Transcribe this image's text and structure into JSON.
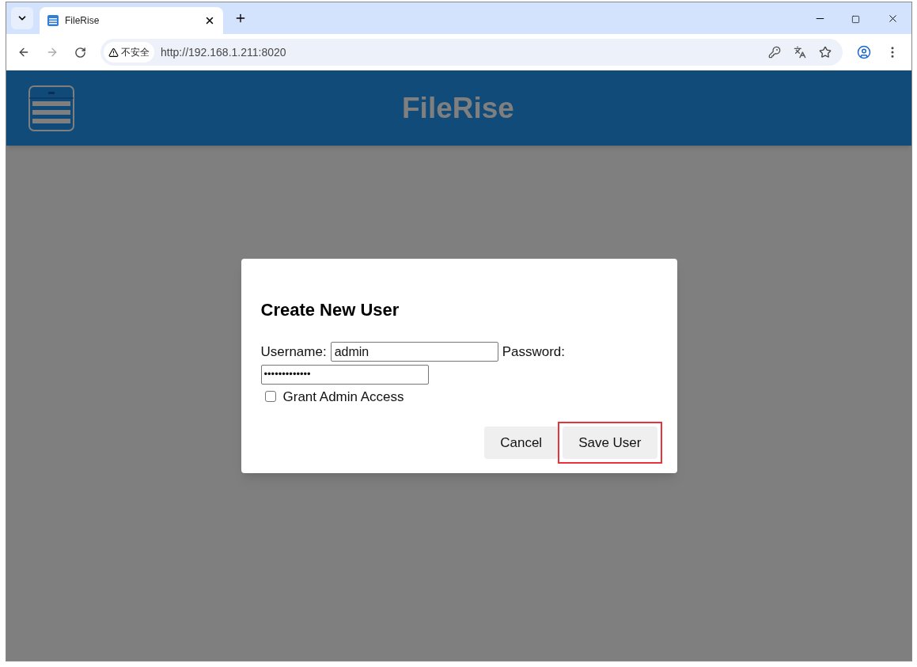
{
  "browser": {
    "tab": {
      "title": "FileRise",
      "selected": true
    },
    "security_label": "不安全",
    "url": "http://192.168.1.211:8020"
  },
  "header": {
    "title": "FileRise"
  },
  "dialog": {
    "title": "Create New User",
    "username": {
      "label": "Username:",
      "value": "admin"
    },
    "password": {
      "label": "Password:",
      "value": "•••••••••••••"
    },
    "admin_access": {
      "label": "Grant Admin Access",
      "checked": false
    },
    "buttons": [
      {
        "label": "Cancel",
        "highlighted": false
      },
      {
        "label": "Save User",
        "highlighted": true
      }
    ]
  }
}
